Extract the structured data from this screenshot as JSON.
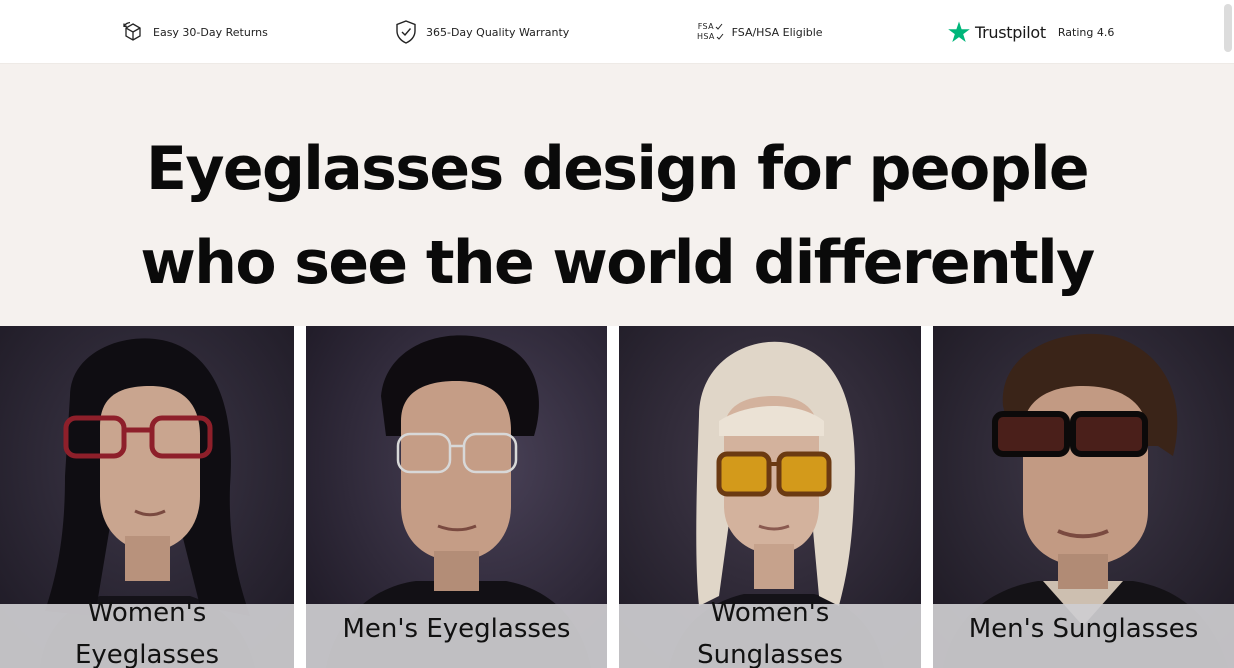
{
  "benefits": [
    {
      "icon": "box-return-icon",
      "label": "Easy 30-Day Returns"
    },
    {
      "icon": "shield-check-icon",
      "label": "365-Day Quality Warranty"
    },
    {
      "icon": "fsa-hsa-icon",
      "label": "FSA/HSA Eligible",
      "fsa": "FSA",
      "hsa": "HSA"
    },
    {
      "icon": "trustpilot-star-icon",
      "brand": "Trustpilot",
      "label": "Rating 4.6"
    }
  ],
  "hero": {
    "title_line1": "Eyeglasses design for people",
    "title_line2": "who see the world differently"
  },
  "categories": [
    {
      "line1": "Women's",
      "line2": "Eyeglasses"
    },
    {
      "label": "Men's Eyeglasses"
    },
    {
      "line1": "Women's",
      "line2": "Sunglasses"
    },
    {
      "label": "Men's Sunglasses"
    }
  ],
  "colors": {
    "hero_bg": "#f5f1ee",
    "trustpilot_green": "#00b67a",
    "label_band": "#cdccd0",
    "photo_bg": "#2a2533"
  }
}
